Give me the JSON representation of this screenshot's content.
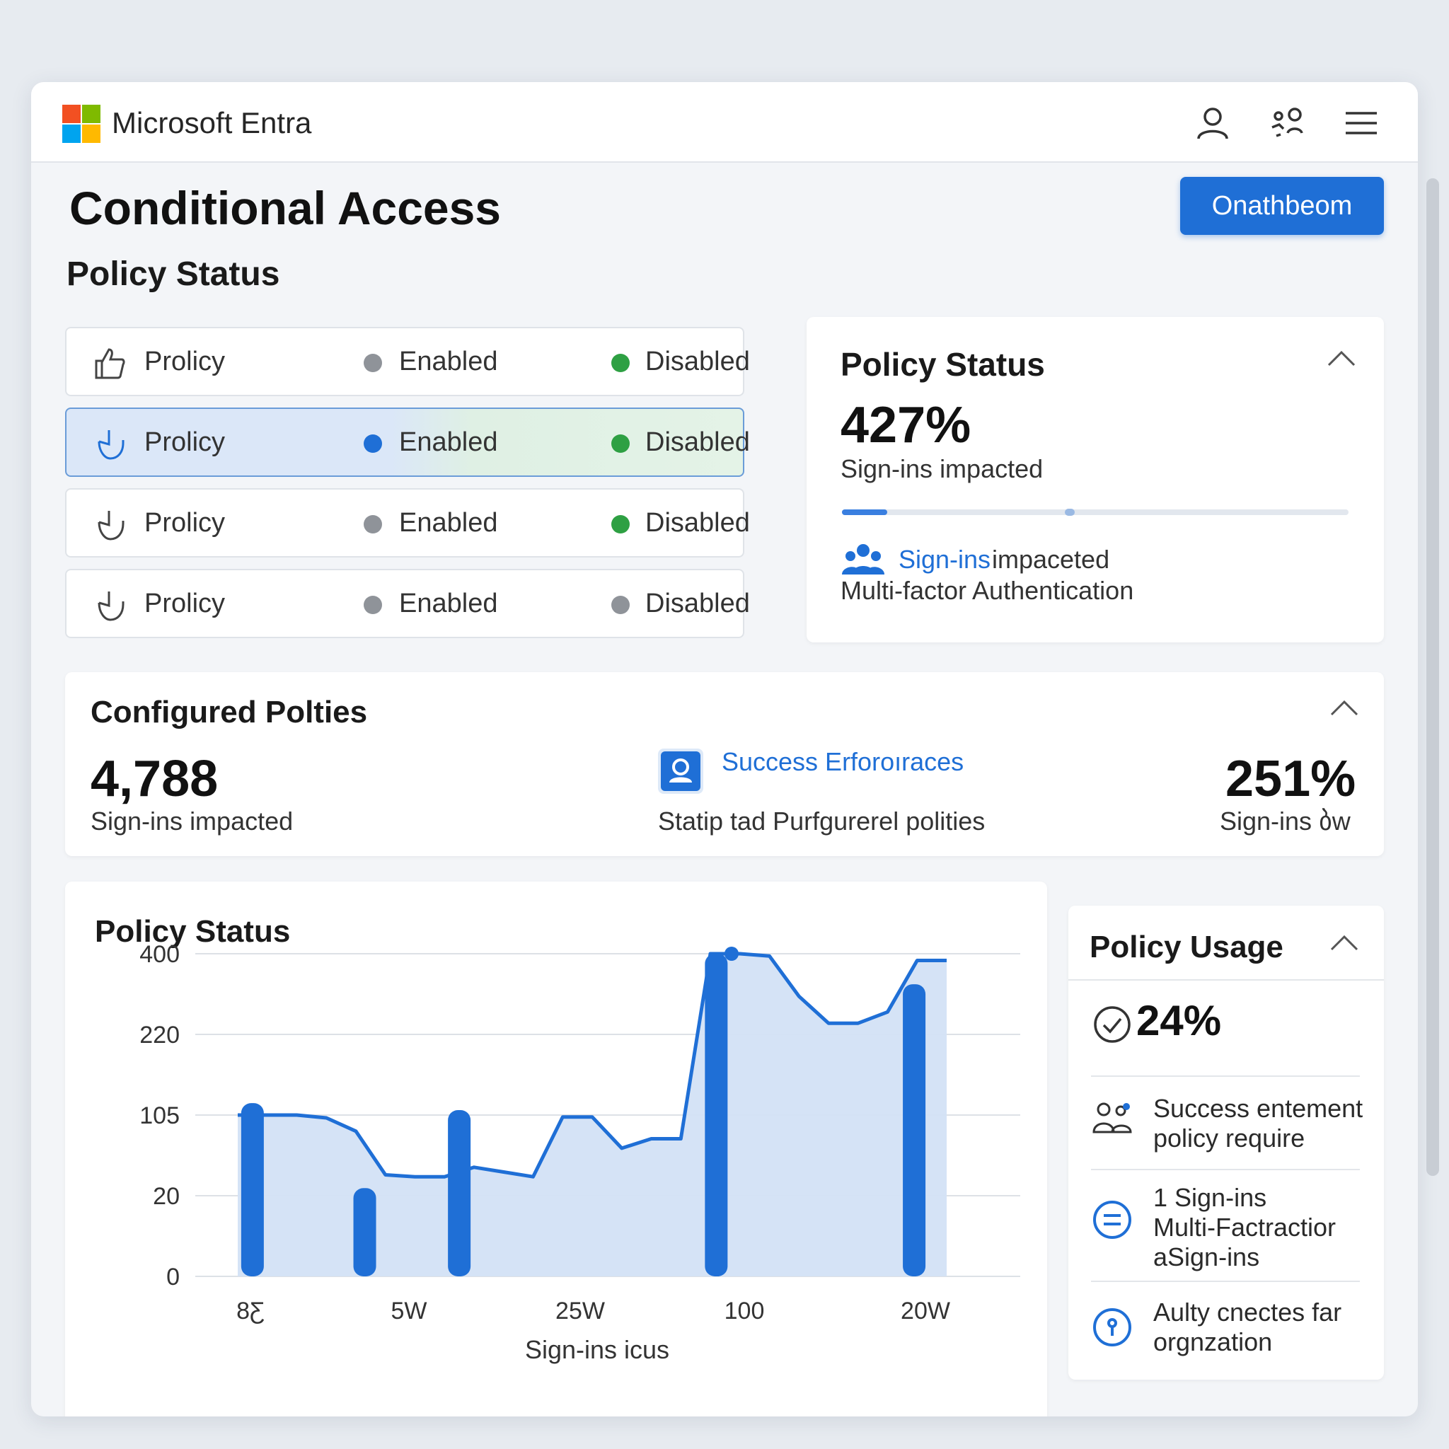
{
  "app": {
    "brand": "Microsoft Entra",
    "page_title": "Conditional Access",
    "primary_button": "Onathbeom",
    "section_title": "Policy Status"
  },
  "policy_rows": [
    {
      "label": "Prolicy",
      "stat1": "Enabled",
      "stat2": "Disabled",
      "dot1": "#8f9399",
      "dot2": "#2ea043",
      "selected": false
    },
    {
      "label": "Prolicy",
      "stat1": "Enabled",
      "stat2": "Disabled",
      "dot1": "#1f6fd6",
      "dot2": "#2ea043",
      "selected": true
    },
    {
      "label": "Prolicy",
      "stat1": "Enabled",
      "stat2": "Disabled",
      "dot1": "#8f9399",
      "dot2": "#2ea043",
      "selected": false
    },
    {
      "label": "Prolicy",
      "stat1": "Enabled",
      "stat2": "Disabled",
      "dot1": "#8f9399",
      "dot2": "#8f9399",
      "selected": false
    }
  ],
  "status_card": {
    "title": "Policy Status",
    "value": "427%",
    "caption": "Sign-ins impacted",
    "progress": 0.09,
    "progress_marker": 0.44,
    "link_text": "Sign-ins",
    "link_suffix": "impaceted",
    "subtext": "Multi-factor Authentication"
  },
  "configured": {
    "title": "Configured Polties",
    "value": "4,788",
    "caption": "Sign-ins impacted",
    "middle_link": "Success Erforoıraces",
    "middle_caption": "Statip tad Purfgurerel polities",
    "right_value": "251%",
    "right_caption": "Sign-ins ბw"
  },
  "chart_data": {
    "type": "area",
    "title": "Policy Status",
    "xlabel": "Sign-ins icus",
    "y_ticks": [
      "400",
      "220",
      "105",
      "20",
      "0"
    ],
    "x_ticks": [
      "8Ƹ",
      "5W",
      "25W",
      "100",
      "20W"
    ],
    "grid": true,
    "series": [
      {
        "values": [
          105,
          105,
          105,
          102,
          88,
          42,
          40,
          40,
          50,
          45,
          40,
          103,
          103,
          70,
          80,
          80,
          400,
          400,
          395,
          305,
          245,
          245,
          270,
          385,
          385
        ]
      }
    ],
    "bars": [
      {
        "position": 0.5,
        "value": 122
      },
      {
        "position": 4.3,
        "value": 28
      },
      {
        "position": 7.5,
        "value": 112
      },
      {
        "position": 16.2,
        "value": 400
      },
      {
        "position": 22.9,
        "value": 332
      }
    ]
  },
  "usage": {
    "title": "Policy Usage",
    "value": "24%",
    "items": [
      {
        "lines": [
          "Success entement",
          "policy require"
        ]
      },
      {
        "lines": [
          "1 Sign-ins",
          "Multi-Factractior",
          "aSign-ins"
        ]
      },
      {
        "lines": [
          "Aulty cnectes far",
          "orgnzation"
        ]
      }
    ]
  },
  "colors": {
    "accent": "#1f6fd6",
    "area_fill": "#d3e2f5",
    "success": "#2ea043",
    "neutral": "#8f9399"
  }
}
